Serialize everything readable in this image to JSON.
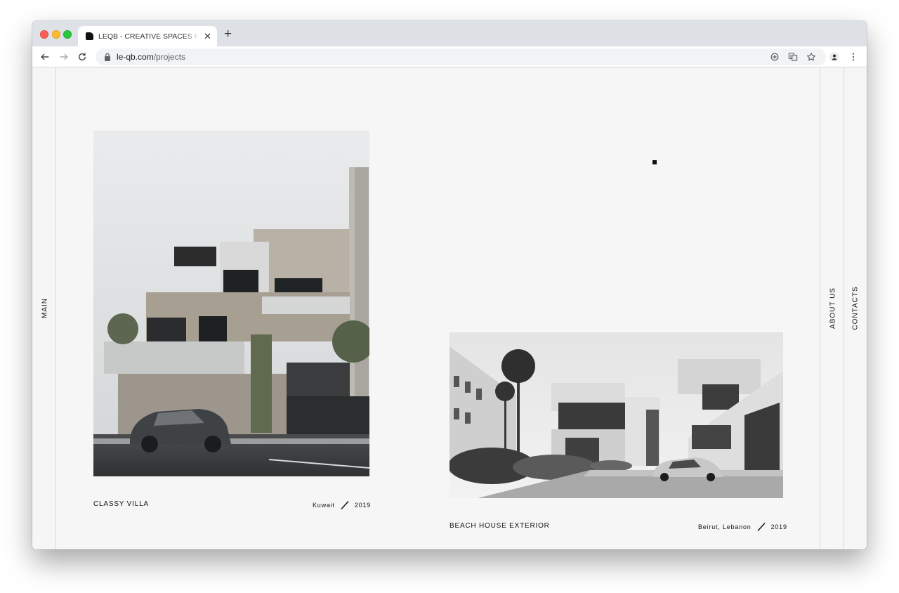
{
  "browser": {
    "tab_title": "LEQB - CREATIVE SPACES FOR LIFE",
    "url_host": "le-qb.com",
    "url_path": "/projects"
  },
  "nav": {
    "left": "MAIN",
    "right_1": "ABOUT US",
    "right_2": "CONTACTS"
  },
  "projects": [
    {
      "title": "CLASSY VILLA",
      "location": "Kuwait",
      "year": "2019"
    },
    {
      "title": "BEACH HOUSE EXTERIOR",
      "location": "Beirut, Lebanon",
      "year": "2019"
    }
  ],
  "icons": {
    "back": "arrow-left-icon",
    "forward": "arrow-right-icon",
    "reload": "reload-icon",
    "lock": "lock-icon",
    "add": "plus-circle-icon",
    "translate": "translate-icon",
    "bookmark": "star-icon",
    "profile": "avatar-icon",
    "menu": "kebab-menu-icon"
  }
}
